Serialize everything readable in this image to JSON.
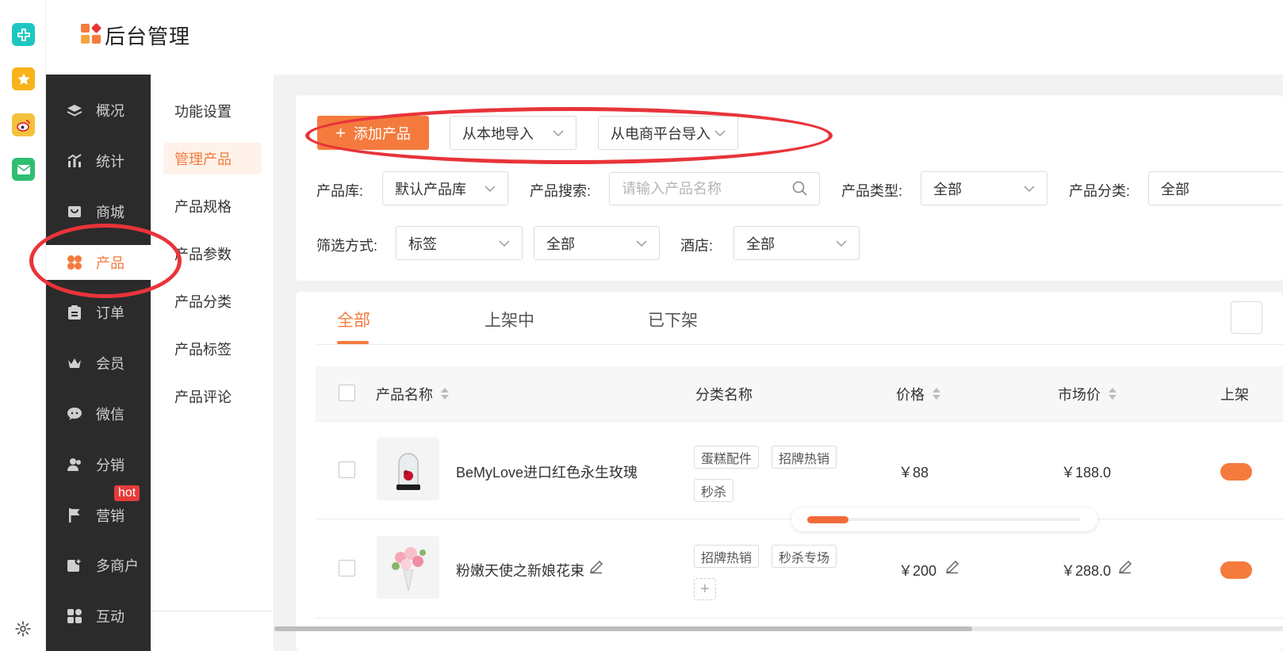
{
  "app": {
    "title": "后台管理",
    "brand_colors": {
      "accent": "#f47b3d",
      "nav_bg": "#2c2b2b",
      "annotation": "#e8343a"
    }
  },
  "rail": {
    "apps": [
      {
        "icon": "plus-cross-app-icon",
        "color": "#1ec6c2"
      },
      {
        "icon": "star-app-icon",
        "color": "#f8b31b"
      },
      {
        "icon": "weibo-app-icon",
        "color": "#f3c23c"
      },
      {
        "icon": "mail-app-icon",
        "color": "#2fbf71"
      }
    ],
    "settings_icon": "gear-icon"
  },
  "mainnav": {
    "items": [
      {
        "label": "概况",
        "icon": "layers-icon"
      },
      {
        "label": "统计",
        "icon": "chart-icon"
      },
      {
        "label": "商城",
        "icon": "shop-icon"
      },
      {
        "label": "产品",
        "icon": "grid-icon",
        "active": true
      },
      {
        "label": "订单",
        "icon": "clipboard-icon"
      },
      {
        "label": "会员",
        "icon": "crown-icon"
      },
      {
        "label": "微信",
        "icon": "chat-icon"
      },
      {
        "label": "分销",
        "icon": "users-icon"
      },
      {
        "label": "营销",
        "icon": "flag-icon"
      },
      {
        "label": "多商户",
        "icon": "store-add-icon"
      },
      {
        "label": "互动",
        "icon": "interact-icon"
      }
    ],
    "hot_badge": "hot"
  },
  "subnav": {
    "items": [
      "功能设置",
      "管理产品",
      "产品规格",
      "产品参数",
      "产品分类",
      "产品标签",
      "产品评论"
    ],
    "active_index": 1
  },
  "toolbar": {
    "add_label": "添加产品",
    "import_local": "从本地导入",
    "import_platform": "从电商平台导入"
  },
  "filters": {
    "library_label": "产品库:",
    "library_value": "默认产品库",
    "search_label": "产品搜索:",
    "search_placeholder": "请输入产品名称",
    "type_label": "产品类型:",
    "type_value": "全部",
    "category_label": "产品分类:",
    "category_value": "全部",
    "filter_label": "筛选方式:",
    "filter_value": "标签",
    "filter_value2": "全部",
    "hotel_label": "酒店:",
    "hotel_value": "全部"
  },
  "tabs": [
    "全部",
    "上架中",
    "已下架"
  ],
  "table": {
    "headers": {
      "name": "产品名称",
      "category": "分类名称",
      "price": "价格",
      "market": "市场价",
      "status": "上架"
    },
    "rows": [
      {
        "name": "BeMyLove进口红色永生玫瑰",
        "tags": [
          "蛋糕配件",
          "招牌热销",
          "秒杀"
        ],
        "price": "￥88",
        "market": "￥188.0",
        "on_shelf": true,
        "editable": false
      },
      {
        "name": "粉嫩天使之新娘花束",
        "tags": [
          "招牌热销",
          "秒杀专场"
        ],
        "price": "￥200",
        "market": "￥288.0",
        "on_shelf": true,
        "editable": true,
        "add_tag": "+"
      }
    ]
  },
  "progress": {
    "value": 0.15
  }
}
